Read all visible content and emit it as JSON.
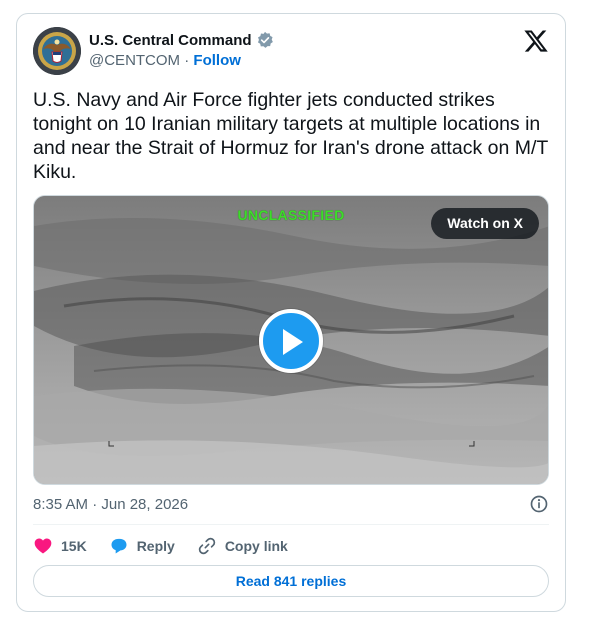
{
  "author": {
    "name": "U.S. Central Command",
    "handle": "@CENTCOM",
    "separator": "·",
    "follow_label": "Follow",
    "verified_color": "#829aab"
  },
  "tweet": {
    "text": "U.S. Navy and Air Force fighter jets conducted strikes tonight on 10 Iranian military targets at multiple locations in and near the Strait of Hormuz for Iran's drone attack on M/T Kiku.",
    "timestamp": "8:35 AM · Jun 28, 2026"
  },
  "media": {
    "overlay_label": "UNCLASSIFIED",
    "overlay_color": "#3ddc2a",
    "watch_label": "Watch on X",
    "play_icon": "play-icon"
  },
  "actions": {
    "like_count": "15K",
    "like_color": "#f91880",
    "reply_label": "Reply",
    "reply_color": "#1d9bf0",
    "copy_link_label": "Copy link"
  },
  "footer": {
    "read_replies_label": "Read 841 replies"
  },
  "colors": {
    "link": "#006fd6",
    "secondary_text": "#536471",
    "border": "#cfd9de"
  }
}
